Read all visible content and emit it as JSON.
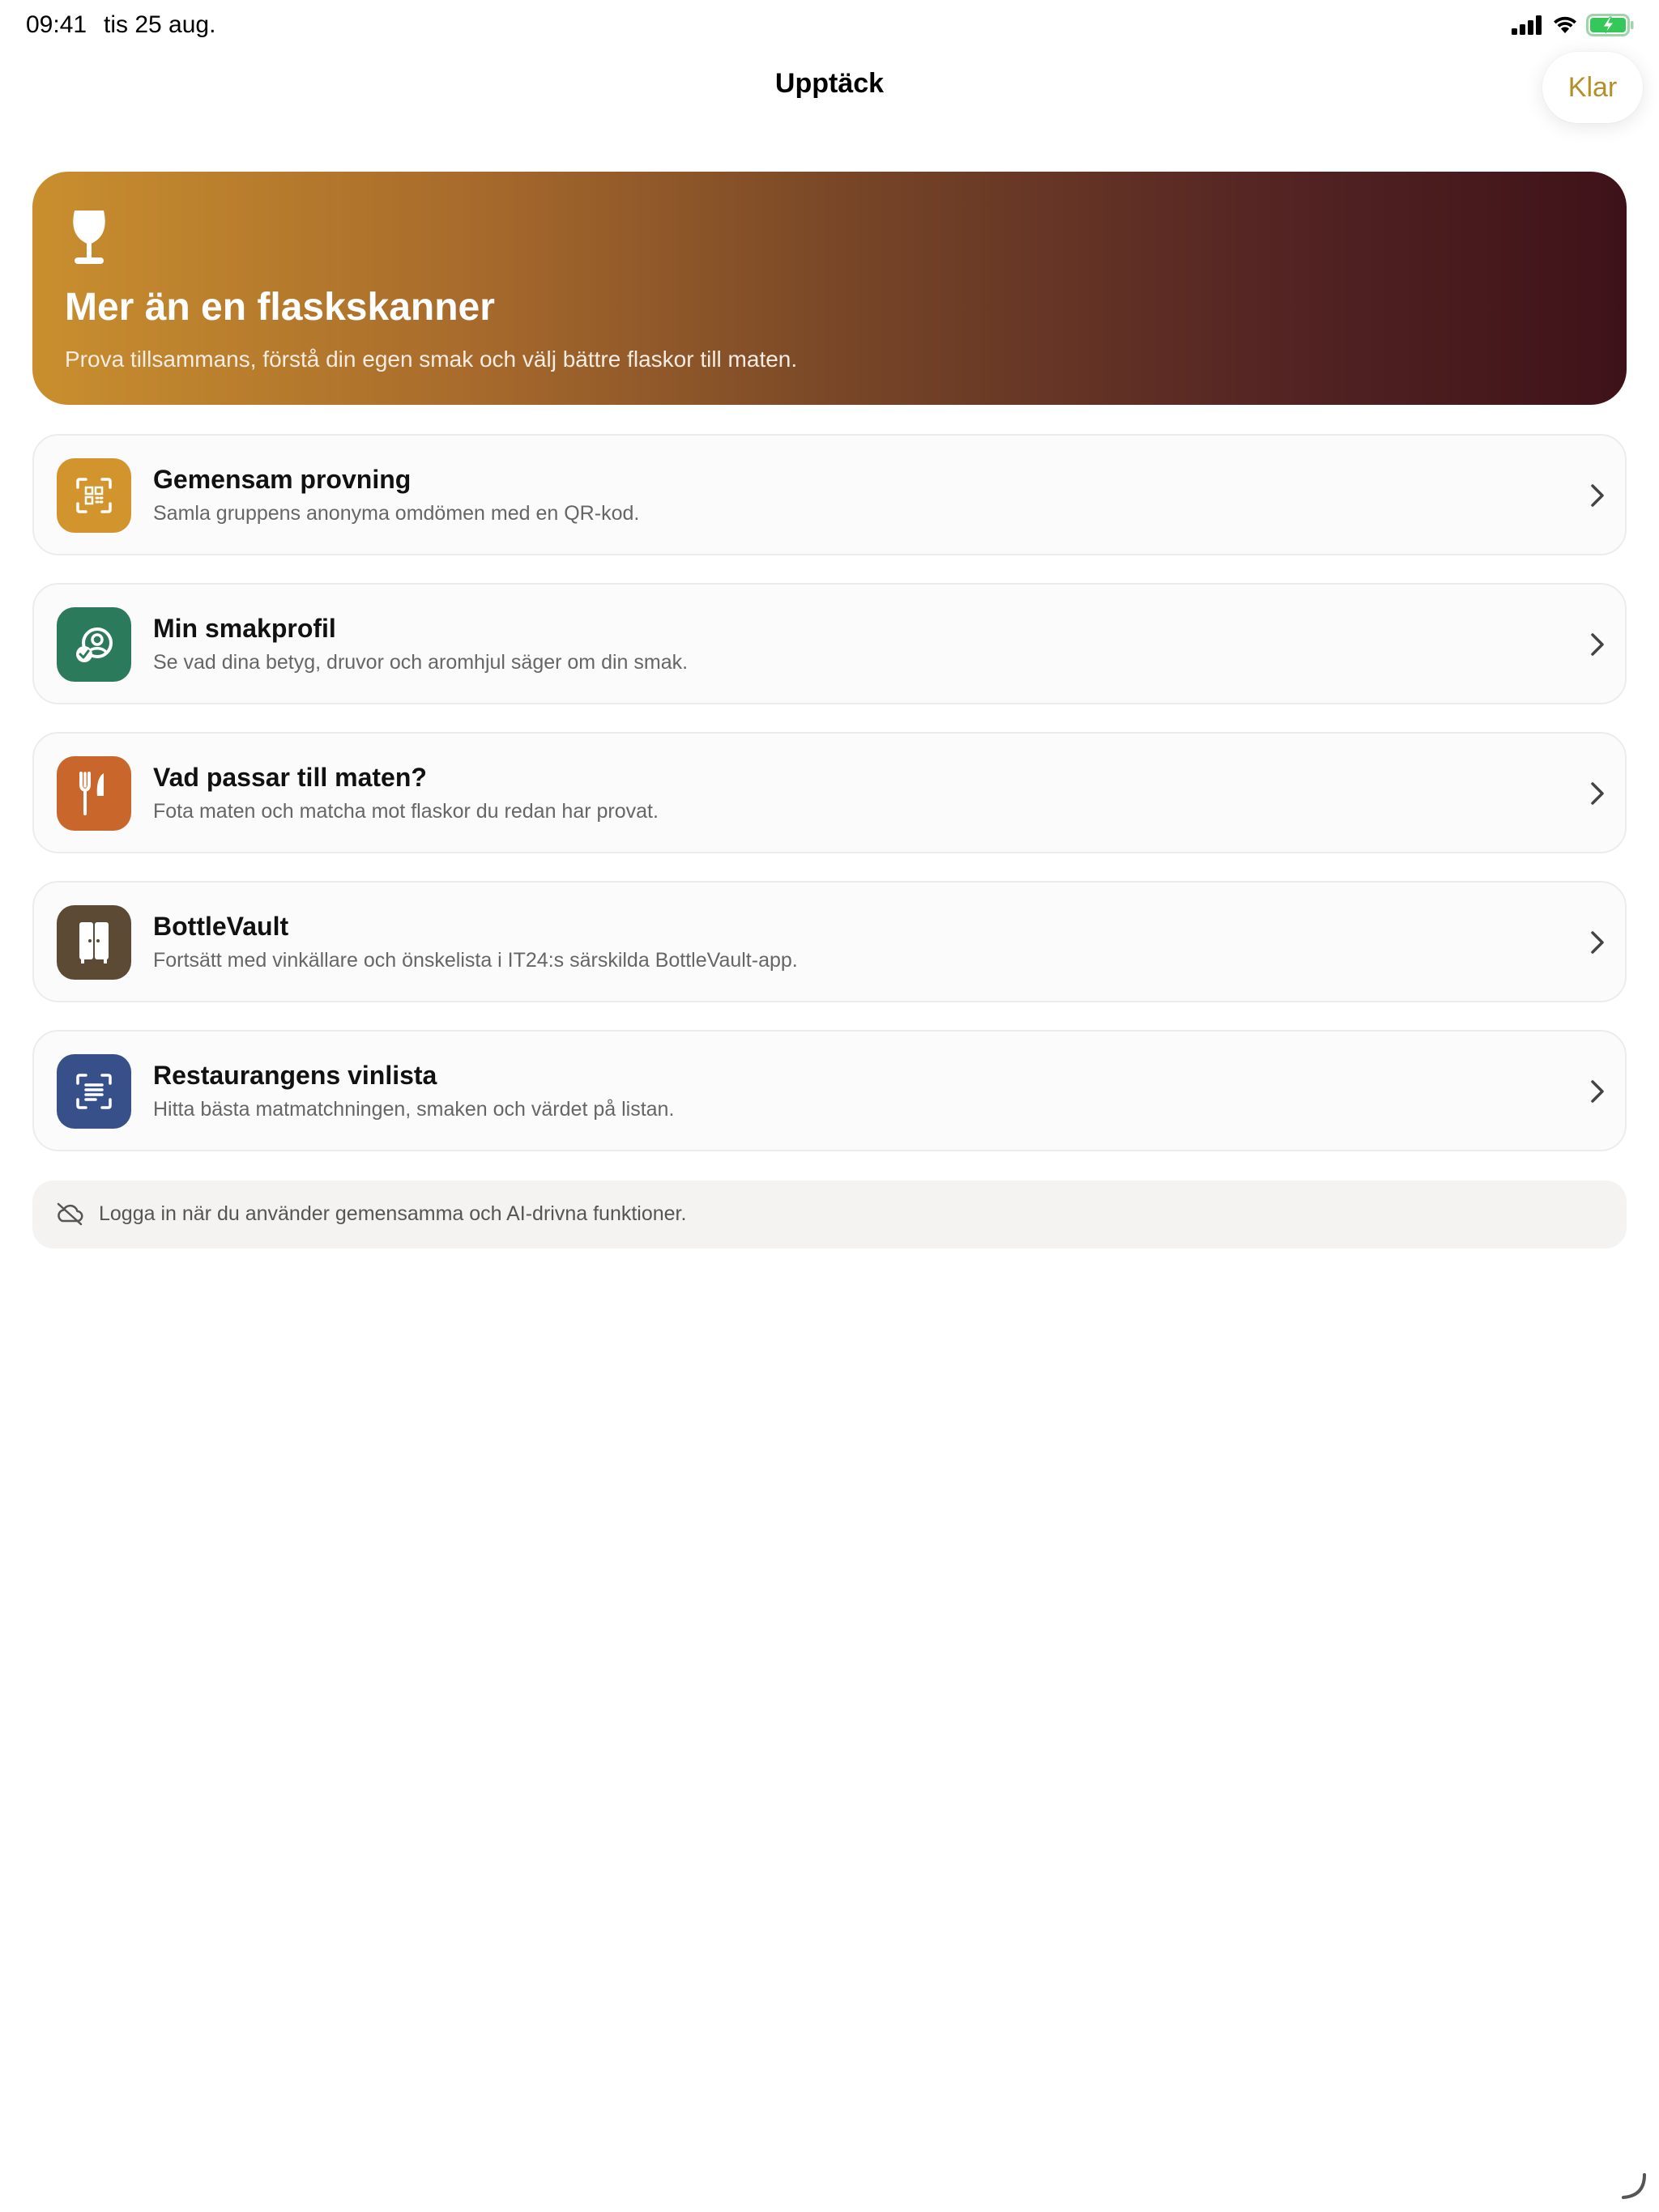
{
  "status_bar": {
    "time": "09:41",
    "date": "tis 25 aug.",
    "icons": [
      "cellular-signal-icon",
      "wifi-icon",
      "battery-charging-icon"
    ]
  },
  "nav": {
    "title": "Upptäck",
    "done_label": "Klar",
    "done_color": "#b39028"
  },
  "hero": {
    "icon": "wine-glass-icon",
    "title": "Mer än en flaskskanner",
    "subtitle": "Prova tillsammans, förstå din egen smak och välj bättre flaskor till maten.",
    "gradient_start": "#c98f2e",
    "gradient_end": "#3e1219"
  },
  "features": [
    {
      "title": "Gemensam provning",
      "description": "Samla gruppens anonyma omdömen med en QR-kod.",
      "icon": "qr-scan-icon",
      "color": "#d2952e"
    },
    {
      "title": "Min smakprofil",
      "description": "Se vad dina betyg, druvor och aromhjul säger om din smak.",
      "icon": "taste-profile-icon",
      "color": "#2c7a5c"
    },
    {
      "title": "Vad passar till maten?",
      "description": "Fota maten och matcha mot flaskor du redan har provat.",
      "icon": "fork-knife-icon",
      "color": "#c8662c"
    },
    {
      "title": "BottleVault",
      "description": "Fortsätt med vinkällare och önskelista i IT24:s särskilda BottleVault-app.",
      "icon": "wine-cabinet-icon",
      "color": "#5c4a34"
    },
    {
      "title": "Restaurangens vinlista",
      "description": "Hitta bästa matmatchningen, smaken och värdet på listan.",
      "icon": "document-scan-icon",
      "color": "#37508a"
    }
  ],
  "info": {
    "icon": "cloud-slash-icon",
    "text": "Logga in när du använder gemensamma och AI-drivna funktioner."
  }
}
